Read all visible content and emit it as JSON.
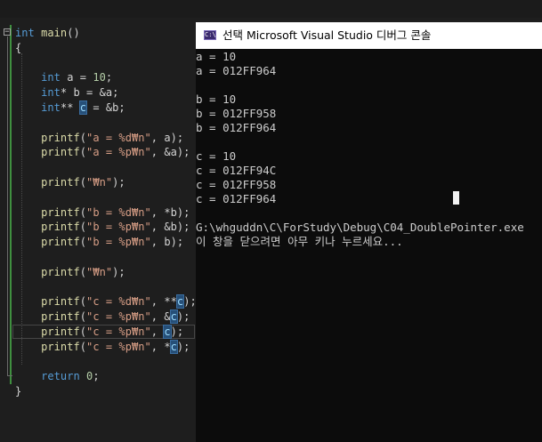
{
  "editor": {
    "fold_symbol": "−",
    "code_lines": [
      [
        {
          "t": "int",
          "c": "kw"
        },
        {
          "t": " "
        },
        {
          "t": "main",
          "c": "fn"
        },
        {
          "t": "()"
        }
      ],
      [
        {
          "t": "{"
        }
      ],
      [
        {
          "t": ""
        }
      ],
      [
        {
          "t": "    "
        },
        {
          "t": "int",
          "c": "kw"
        },
        {
          "t": " a = "
        },
        {
          "t": "10",
          "c": "num"
        },
        {
          "t": ";"
        }
      ],
      [
        {
          "t": "    "
        },
        {
          "t": "int",
          "c": "kw"
        },
        {
          "t": "* b = &a;"
        }
      ],
      [
        {
          "t": "    "
        },
        {
          "t": "int",
          "c": "kw"
        },
        {
          "t": "** "
        },
        {
          "t": "c",
          "c": "sel"
        },
        {
          "t": " = &b;"
        }
      ],
      [
        {
          "t": ""
        }
      ],
      [
        {
          "t": "    "
        },
        {
          "t": "printf",
          "c": "fn"
        },
        {
          "t": "("
        },
        {
          "t": "\"a = %d₩n\"",
          "c": "str"
        },
        {
          "t": ", a);"
        }
      ],
      [
        {
          "t": "    "
        },
        {
          "t": "printf",
          "c": "fn"
        },
        {
          "t": "("
        },
        {
          "t": "\"a = %p₩n\"",
          "c": "str"
        },
        {
          "t": ", &a);"
        }
      ],
      [
        {
          "t": ""
        }
      ],
      [
        {
          "t": "    "
        },
        {
          "t": "printf",
          "c": "fn"
        },
        {
          "t": "("
        },
        {
          "t": "\"₩n\"",
          "c": "str"
        },
        {
          "t": ");"
        }
      ],
      [
        {
          "t": ""
        }
      ],
      [
        {
          "t": "    "
        },
        {
          "t": "printf",
          "c": "fn"
        },
        {
          "t": "("
        },
        {
          "t": "\"b = %d₩n\"",
          "c": "str"
        },
        {
          "t": ", *b);"
        }
      ],
      [
        {
          "t": "    "
        },
        {
          "t": "printf",
          "c": "fn"
        },
        {
          "t": "("
        },
        {
          "t": "\"b = %p₩n\"",
          "c": "str"
        },
        {
          "t": ", &b);"
        }
      ],
      [
        {
          "t": "    "
        },
        {
          "t": "printf",
          "c": "fn"
        },
        {
          "t": "("
        },
        {
          "t": "\"b = %p₩n\"",
          "c": "str"
        },
        {
          "t": ", b);"
        }
      ],
      [
        {
          "t": ""
        }
      ],
      [
        {
          "t": "    "
        },
        {
          "t": "printf",
          "c": "fn"
        },
        {
          "t": "("
        },
        {
          "t": "\"₩n\"",
          "c": "str"
        },
        {
          "t": ");"
        }
      ],
      [
        {
          "t": ""
        }
      ],
      [
        {
          "t": "    "
        },
        {
          "t": "printf",
          "c": "fn"
        },
        {
          "t": "("
        },
        {
          "t": "\"c = %d₩n\"",
          "c": "str"
        },
        {
          "t": ", **"
        },
        {
          "t": "c",
          "c": "sel"
        },
        {
          "t": ");"
        }
      ],
      [
        {
          "t": "    "
        },
        {
          "t": "printf",
          "c": "fn"
        },
        {
          "t": "("
        },
        {
          "t": "\"c = %p₩n\"",
          "c": "str"
        },
        {
          "t": ", &"
        },
        {
          "t": "c",
          "c": "sel"
        },
        {
          "t": ");"
        }
      ],
      [
        {
          "t": "    "
        },
        {
          "t": "printf",
          "c": "fn"
        },
        {
          "t": "("
        },
        {
          "t": "\"c = %p₩n\"",
          "c": "str"
        },
        {
          "t": ", "
        },
        {
          "t": "c",
          "c": "sel"
        },
        {
          "t": ");"
        }
      ],
      [
        {
          "t": "    "
        },
        {
          "t": "printf",
          "c": "fn"
        },
        {
          "t": "("
        },
        {
          "t": "\"c = %p₩n\"",
          "c": "str"
        },
        {
          "t": ", *"
        },
        {
          "t": "c",
          "c": "sel"
        },
        {
          "t": ");"
        }
      ],
      [
        {
          "t": ""
        }
      ],
      [
        {
          "t": "    "
        },
        {
          "t": "return",
          "c": "kw"
        },
        {
          "t": " "
        },
        {
          "t": "0",
          "c": "num"
        },
        {
          "t": ";"
        }
      ],
      [
        {
          "t": "}"
        }
      ]
    ]
  },
  "console": {
    "title": "선택 Microsoft Visual Studio 디버그 콘솔",
    "icon_glyph": "C:\\",
    "output_lines": [
      "a = 10",
      "a = 012FF964",
      "",
      "b = 10",
      "b = 012FF958",
      "b = 012FF964",
      "",
      "c = 10",
      "c = 012FF94C",
      "c = 012FF958",
      "c = 012FF964",
      "",
      "G:\\whguddn\\C\\ForStudy\\Debug\\C04_DoublePointer.exe",
      "이 창을 닫으려면 아무 키나 누르세요..."
    ]
  }
}
